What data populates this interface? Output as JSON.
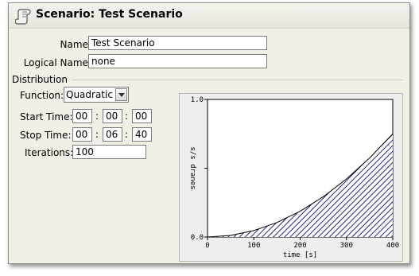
{
  "header": {
    "title": "Scenario: Test Scenario",
    "icon": "scroll-icon"
  },
  "form": {
    "name_label": "Name:",
    "name_value": "Test Scenario",
    "logical_label": "Logical Name:",
    "logical_value": "none"
  },
  "distribution": {
    "section_label": "Distribution",
    "function_label": "Function:",
    "function_value": "Quadratic",
    "start_label": "Start Time:",
    "start": {
      "h": "00",
      "m": "00",
      "s": "00"
    },
    "stop_label": "Stop Time:",
    "stop": {
      "h": "00",
      "m": "06",
      "s": "40"
    },
    "time_separator": ":",
    "iterations_label": "Iterations:",
    "iterations_value": "100"
  },
  "chart_data": {
    "type": "area",
    "xlabel": "time [s]",
    "ylabel": "s/s dranes",
    "xlim": [
      0,
      400
    ],
    "ylim": [
      0,
      1.0
    ],
    "x_ticks": [
      "0",
      "100",
      "200",
      "300",
      "400"
    ],
    "y_ticks": [
      "0.0",
      "1.0"
    ],
    "x": [
      0,
      50,
      100,
      150,
      200,
      250,
      300,
      350,
      400
    ],
    "y": [
      0,
      0.0117,
      0.0469,
      0.1055,
      0.1875,
      0.293,
      0.4219,
      0.5742,
      0.75
    ],
    "fill_color": "#22228a",
    "fill_pattern": "diagonal hatch"
  }
}
